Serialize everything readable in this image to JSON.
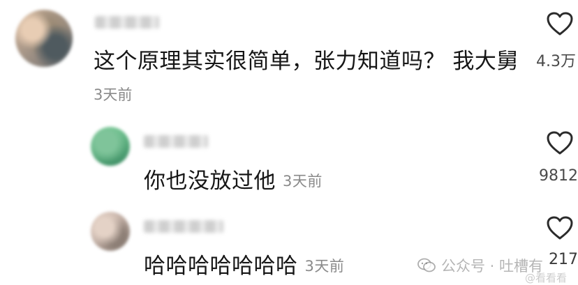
{
  "comments": [
    {
      "text": "这个原理其实很简单，张力知道吗？ 我大舅",
      "time": "3天前",
      "likes": "4.3万"
    },
    {
      "text": "你也没放过他",
      "time": "3天前",
      "likes": "9812"
    },
    {
      "text": "哈哈哈哈哈哈哈",
      "time": "3天前",
      "likes": "217"
    }
  ],
  "watermark": {
    "text": "公众号 · 吐槽有",
    "secondary": "@看看看"
  },
  "icons": {
    "like": "heart-outline-icon",
    "watermark": "wechat-icon"
  },
  "colors": {
    "text": "#161616",
    "meta": "#8a8a8a",
    "icon": "#2b2b2b"
  }
}
